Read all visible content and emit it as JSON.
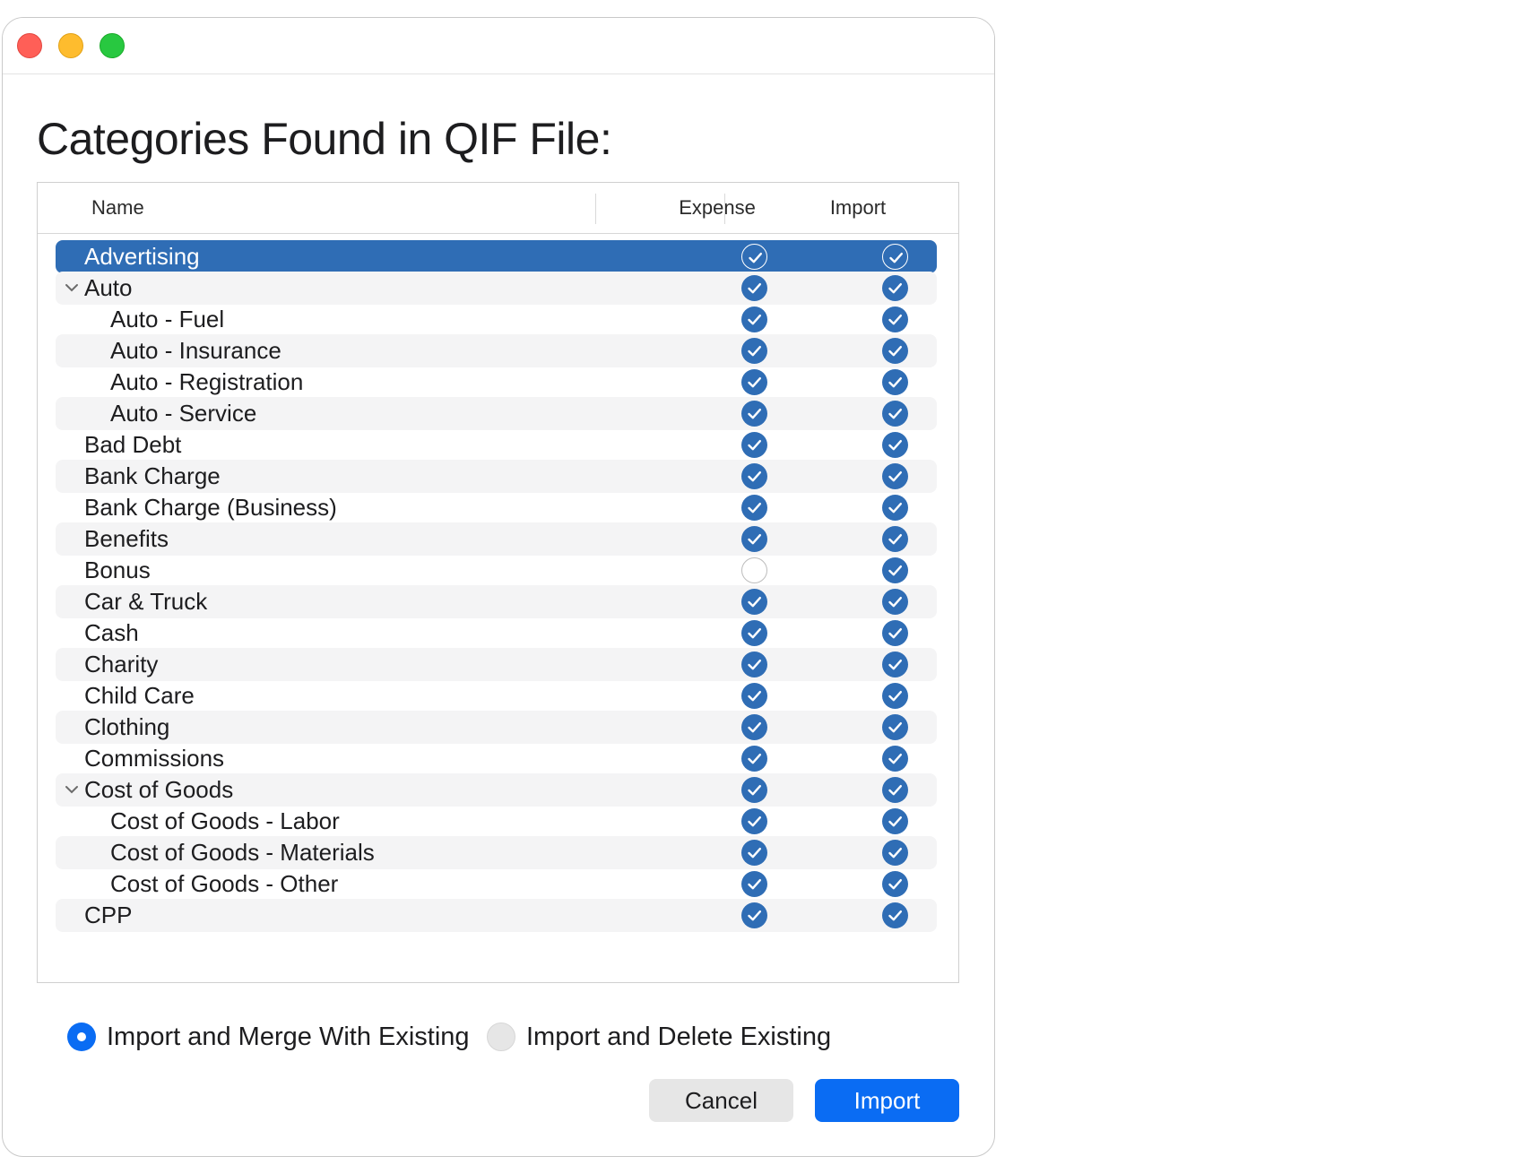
{
  "window": {
    "title": "Categories Found in QIF File:"
  },
  "table": {
    "columns": {
      "name": "Name",
      "expense": "Expense",
      "import": "Import"
    },
    "rows": [
      {
        "label": "Advertising",
        "indent": 0,
        "disclosure": false,
        "expense": true,
        "import": true,
        "selected": true
      },
      {
        "label": "Auto",
        "indent": 0,
        "disclosure": true,
        "expense": true,
        "import": true
      },
      {
        "label": "Auto - Fuel",
        "indent": 1,
        "disclosure": false,
        "expense": true,
        "import": true
      },
      {
        "label": "Auto - Insurance",
        "indent": 1,
        "disclosure": false,
        "expense": true,
        "import": true
      },
      {
        "label": "Auto - Registration",
        "indent": 1,
        "disclosure": false,
        "expense": true,
        "import": true
      },
      {
        "label": "Auto - Service",
        "indent": 1,
        "disclosure": false,
        "expense": true,
        "import": true
      },
      {
        "label": "Bad Debt",
        "indent": 0,
        "disclosure": false,
        "expense": true,
        "import": true
      },
      {
        "label": "Bank Charge",
        "indent": 0,
        "disclosure": false,
        "expense": true,
        "import": true
      },
      {
        "label": "Bank Charge (Business)",
        "indent": 0,
        "disclosure": false,
        "expense": true,
        "import": true
      },
      {
        "label": "Benefits",
        "indent": 0,
        "disclosure": false,
        "expense": true,
        "import": true
      },
      {
        "label": "Bonus",
        "indent": 0,
        "disclosure": false,
        "expense": false,
        "import": true
      },
      {
        "label": "Car & Truck",
        "indent": 0,
        "disclosure": false,
        "expense": true,
        "import": true
      },
      {
        "label": "Cash",
        "indent": 0,
        "disclosure": false,
        "expense": true,
        "import": true
      },
      {
        "label": "Charity",
        "indent": 0,
        "disclosure": false,
        "expense": true,
        "import": true
      },
      {
        "label": "Child Care",
        "indent": 0,
        "disclosure": false,
        "expense": true,
        "import": true
      },
      {
        "label": "Clothing",
        "indent": 0,
        "disclosure": false,
        "expense": true,
        "import": true
      },
      {
        "label": "Commissions",
        "indent": 0,
        "disclosure": false,
        "expense": true,
        "import": true
      },
      {
        "label": "Cost of Goods",
        "indent": 0,
        "disclosure": true,
        "expense": true,
        "import": true
      },
      {
        "label": "Cost of Goods - Labor",
        "indent": 1,
        "disclosure": false,
        "expense": true,
        "import": true
      },
      {
        "label": "Cost of Goods - Materials",
        "indent": 1,
        "disclosure": false,
        "expense": true,
        "import": true
      },
      {
        "label": "Cost of Goods - Other",
        "indent": 1,
        "disclosure": false,
        "expense": true,
        "import": true
      },
      {
        "label": "CPP",
        "indent": 0,
        "disclosure": false,
        "expense": true,
        "import": true
      }
    ]
  },
  "options": {
    "merge_label": "Import and Merge With Existing",
    "delete_label": "Import and Delete Existing",
    "selected": "merge"
  },
  "buttons": {
    "cancel": "Cancel",
    "import": "Import"
  },
  "colors": {
    "accent": "#0a6cf3",
    "selection": "#2f6db5",
    "checkbox": "#2f6db5"
  },
  "icons": {
    "close": "red-circle-icon",
    "minimize": "yellow-circle-icon",
    "maximize": "green-circle-icon",
    "checkbox": "checkmark-circle-icon",
    "disclosure": "chevron-down-icon"
  }
}
